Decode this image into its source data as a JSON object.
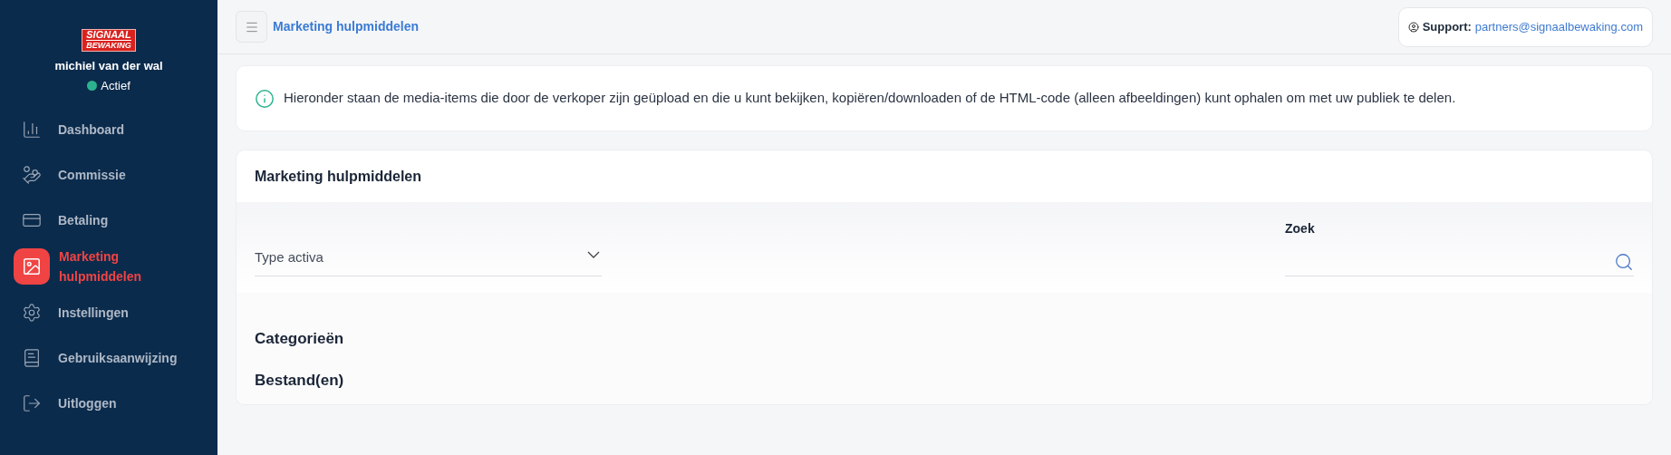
{
  "sidebar": {
    "logo": {
      "line_1": "SIGNAAL",
      "line_2": "BEWAKING"
    },
    "user": {
      "name": "michiel van der wal",
      "status": "Actief",
      "active": true
    },
    "items": [
      {
        "kind": "dashboard",
        "label": "Dashboard",
        "selected": false
      },
      {
        "kind": "commission",
        "label": "Commissie",
        "selected": false
      },
      {
        "kind": "payment",
        "label": "Betaling",
        "selected": false
      },
      {
        "kind": "marketing",
        "label": "Marketing hulpmiddelen",
        "selected": true
      },
      {
        "kind": "settings",
        "label": "Instellingen",
        "selected": false
      },
      {
        "kind": "manual",
        "label": "Gebruiksaanwijzing",
        "selected": false
      },
      {
        "kind": "logout",
        "label": "Uitloggen",
        "selected": false
      }
    ]
  },
  "header": {
    "title": "Marketing hulpmiddelen",
    "support_label": "Support:",
    "support_email": "partners@signaalbewaking.com"
  },
  "info": "Hieronder staan de media-items die door de verkoper zijn geüpload en die u kunt bekijken, kopiëren/downloaden of de HTML-code (alleen afbeeldingen) kunt ophalen om met uw publiek te delen.",
  "card": {
    "title": "Marketing hulpmiddelen",
    "type_select": {
      "placeholder": "Type activa"
    },
    "search": {
      "label": "Zoek"
    },
    "sections": [
      "Categorieën",
      "Bestand(en)"
    ]
  }
}
